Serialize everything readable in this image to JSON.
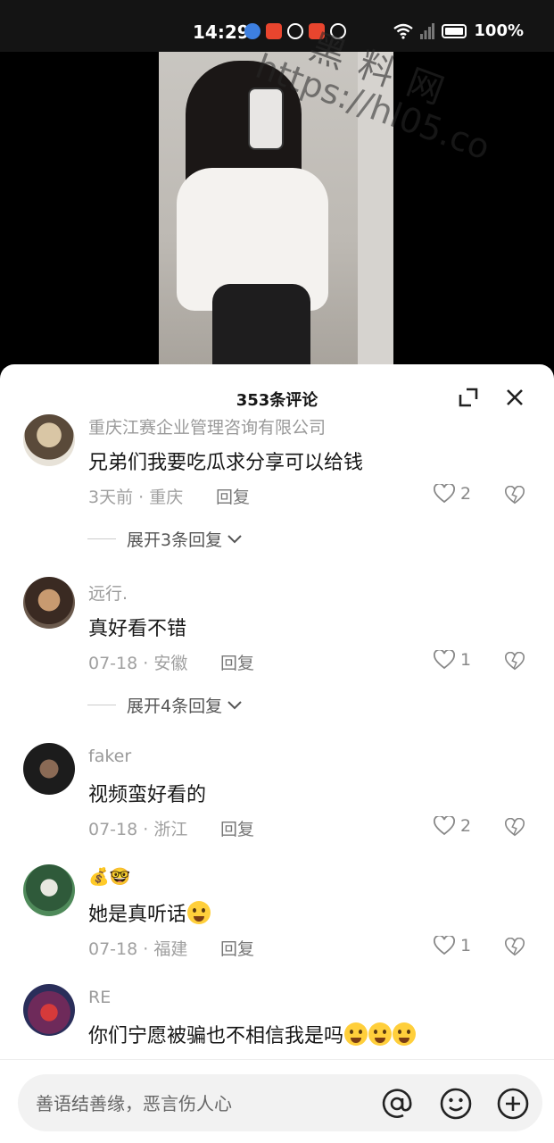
{
  "status_bar": {
    "time": "14:29",
    "battery": "100%"
  },
  "watermark": {
    "title": "黑料网",
    "url": "https://hl05.co"
  },
  "comments_sheet": {
    "title": "353条评论",
    "comments": [
      {
        "user": "重庆江赛企业管理咨询有限公司",
        "text": "兄弟们我要吃瓜求分享可以给钱",
        "time": "3天前",
        "location": "重庆",
        "reply_label": "回复",
        "likes": "2",
        "expand_label": "展开3条回复"
      },
      {
        "user": "远行.",
        "text": "真好看不错",
        "time": "07-18",
        "location": "安徽",
        "reply_label": "回复",
        "likes": "1",
        "expand_label": "展开4条回复"
      },
      {
        "user": "faker",
        "text": "视频蛮好看的",
        "time": "07-18",
        "location": "浙江",
        "reply_label": "回复",
        "likes": "2"
      },
      {
        "user": "💰🤓",
        "text": "她是真听话",
        "time": "07-18",
        "location": "福建",
        "reply_label": "回复",
        "likes": "1"
      },
      {
        "user": "RE",
        "text": "你们宁愿被骗也不相信我是吗"
      }
    ]
  },
  "input_bar": {
    "placeholder": "善语结善缘，恶言伤人心"
  },
  "icons": {
    "mention": "at-icon",
    "emoji": "smiley-icon",
    "add": "plus-circle-icon"
  }
}
